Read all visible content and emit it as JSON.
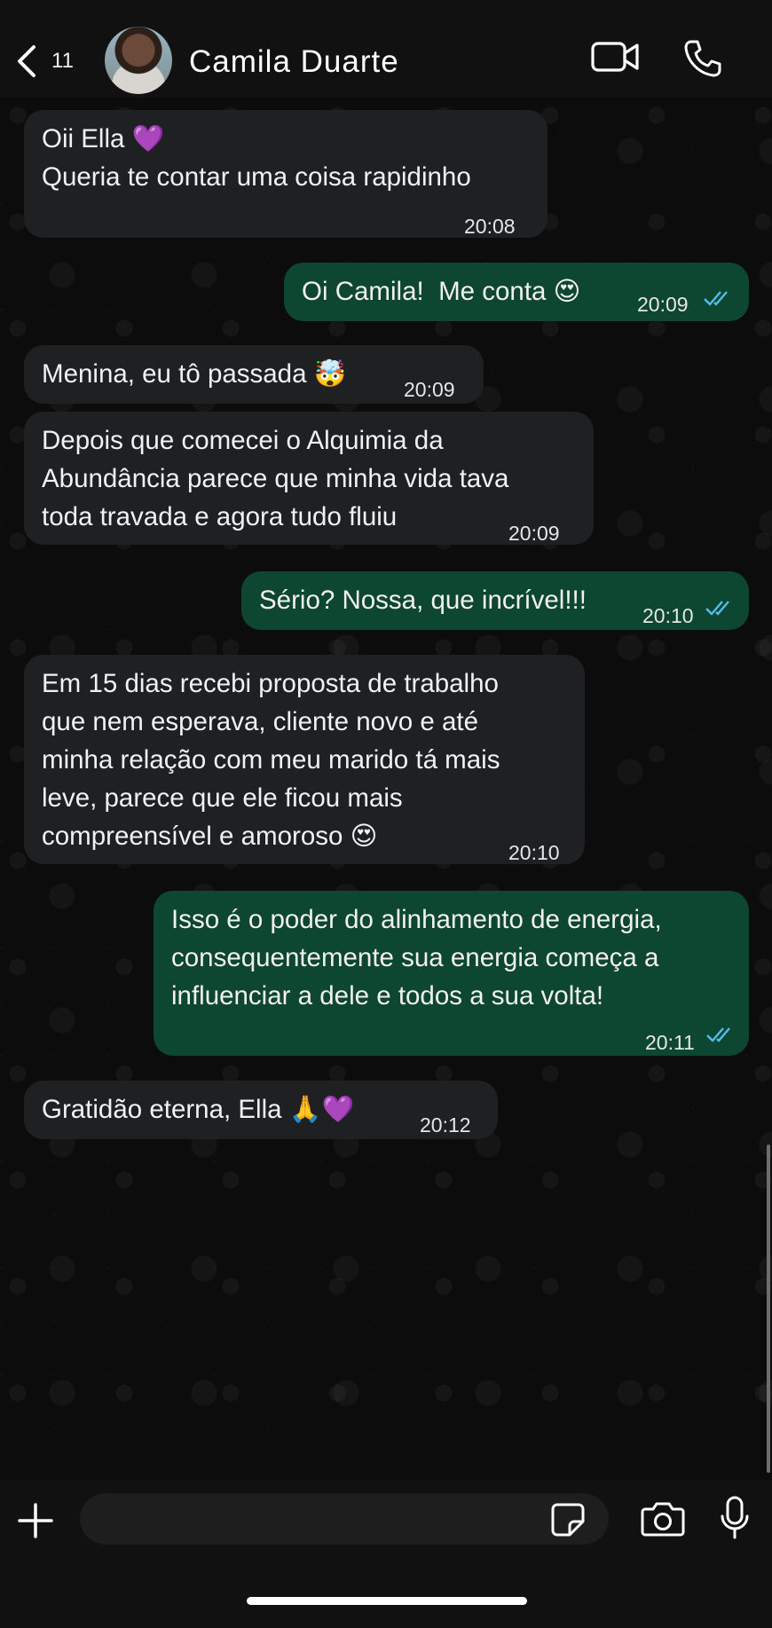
{
  "header": {
    "back_count": "11",
    "contact_name": "Camila Duarte"
  },
  "messages": [
    {
      "direction": "in",
      "lines": [
        "Oii Ella 💜",
        "Queria te contar uma coisa rapidinho"
      ],
      "time": "20:08"
    },
    {
      "direction": "out",
      "lines": [
        "Oi Camila!  Me conta 😍"
      ],
      "time": "20:09",
      "read": true
    },
    {
      "direction": "in",
      "lines": [
        "Menina, eu tô passada 🤯"
      ],
      "time": "20:09"
    },
    {
      "direction": "in",
      "lines": [
        "Depois que comecei o Alquimia da",
        "Abundância parece que minha vida tava",
        "toda travada e agora tudo fluiu"
      ],
      "time": "20:09"
    },
    {
      "direction": "out",
      "lines": [
        "Sério? Nossa, que incrível!!!"
      ],
      "time": "20:10",
      "read": true
    },
    {
      "direction": "in",
      "lines": [
        "Em 15 dias recebi proposta de trabalho",
        "que nem esperava, cliente novo e até",
        "minha relação com meu marido tá mais",
        "leve, parece que ele ficou mais",
        "compreensível e amoroso 😍"
      ],
      "time": "20:10"
    },
    {
      "direction": "out",
      "lines": [
        "Isso é o poder do alinhamento de energia,",
        "consequentemente sua energia começa a",
        "influenciar a dele e todos a sua volta!"
      ],
      "time": "20:11",
      "read": true
    },
    {
      "direction": "in",
      "lines": [
        "Gratidão eterna, Ella 🙏💜"
      ],
      "time": "20:12"
    }
  ],
  "composer": {
    "input_value": "",
    "placeholder": ""
  },
  "colors": {
    "incoming_bubble": "#1f2022",
    "outgoing_bubble": "#0d4631",
    "read_ticks": "#53bdeb"
  },
  "icons": [
    "chevron-left-icon",
    "video-call-icon",
    "phone-icon",
    "plus-icon",
    "sticker-icon",
    "camera-icon",
    "microphone-icon",
    "double-check-icon"
  ]
}
